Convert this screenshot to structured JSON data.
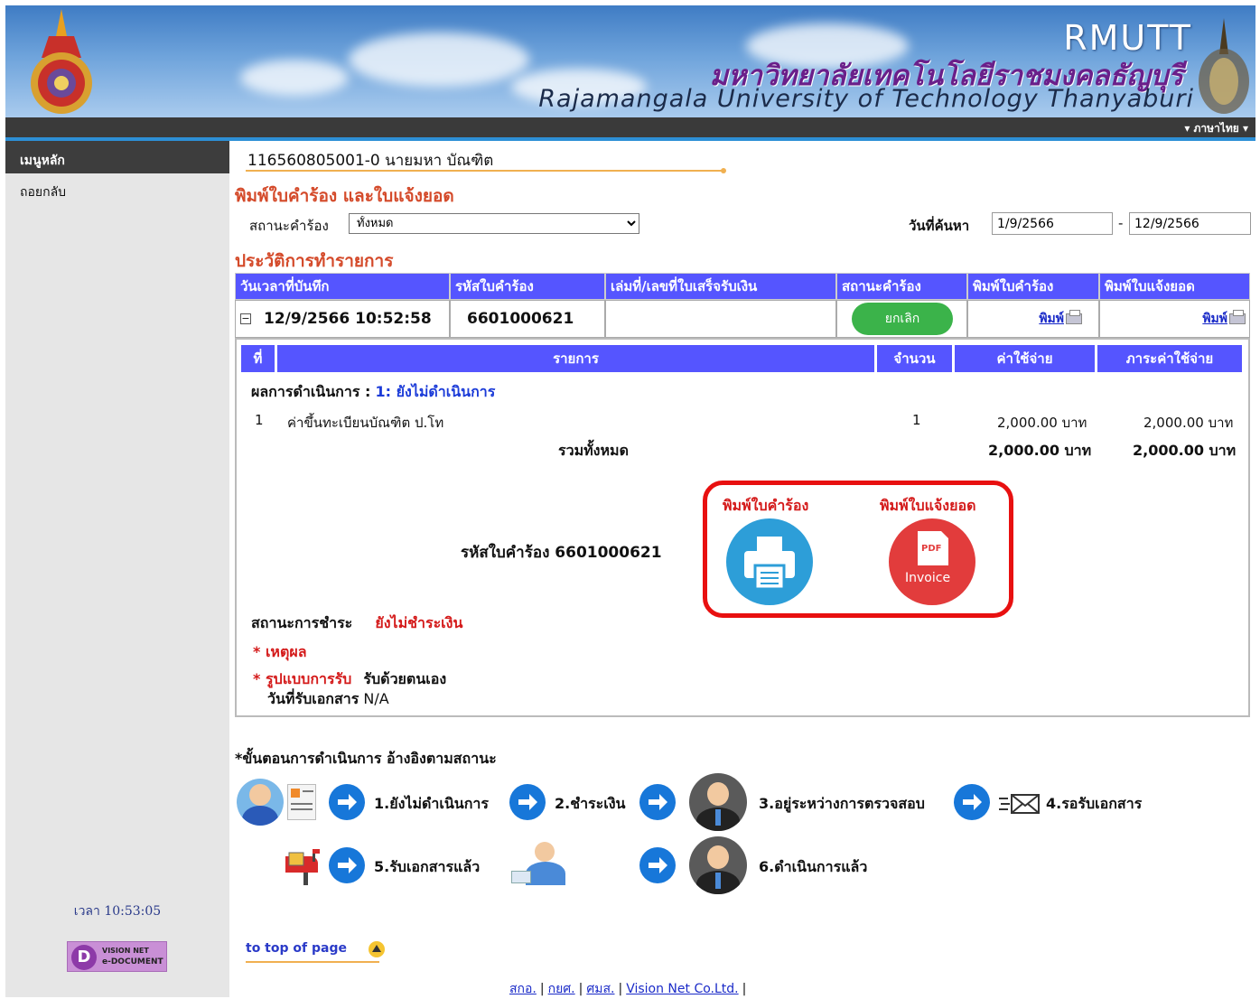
{
  "header": {
    "brand_short": "RMUTT",
    "brand_thai": "มหาวิทยาลัยเทคโนโลยีราชมงคลธัญบุรี",
    "brand_english": "Rajamangala University of Technology Thanyaburi",
    "language": "▾ ภาษาไทย ▾"
  },
  "sidebar": {
    "main_menu": "เมนูหลัก",
    "back": "ถอยกลับ",
    "clock": "เวลา 10:53:05",
    "vision_logo_line1": "VISION NET",
    "vision_logo_line2": "e-DOCUMENT"
  },
  "student": {
    "id_name": "116560805001-0 นายมหา  บัณฑิต"
  },
  "page_title": "พิมพ์ใบคำร้อง และใบแจ้งยอด",
  "filter": {
    "status_label": "สถานะคำร้อง",
    "status_value": "ทั้งหมด",
    "date_label": "วันที่ค้นหา",
    "date_from": "1/9/2566",
    "date_sep": "-",
    "date_to": "12/9/2566"
  },
  "history": {
    "title": "ประวัติการทำรายการ",
    "columns": [
      "วันเวลาที่บันทึก",
      "รหัสใบคำร้อง",
      "เล่มที่/เลขที่ใบเสร็จรับเงิน",
      "สถานะคำร้อง",
      "พิมพ์ใบคำร้อง",
      "พิมพ์ใบแจ้งยอด"
    ],
    "row": {
      "toggle": "⊟",
      "datetime": "12/9/2566 10:52:58",
      "request_code": "6601000621",
      "receipt": "",
      "status_button": "ยกเลิก",
      "print_request": "พิมพ์",
      "print_invoice": "พิมพ์"
    }
  },
  "detail": {
    "columns": [
      "ที่",
      "รายการ",
      "จำนวน",
      "ค่าใช้จ่าย",
      "ภาระค่าใช้จ่าย"
    ],
    "process_label": "ผลการดำเนินการ  :",
    "process_value": "1: ยังไม่ดำเนินการ",
    "items": [
      {
        "no": "1",
        "name": "ค่าขึ้นทะเบียนบัณฑิต ป.โท",
        "qty": "1",
        "cost": "2,000.00 บาท",
        "charge": "2,000.00 บาท"
      }
    ],
    "total_label": "รวมทั้งหมด",
    "total_cost": "2,000.00 บาท",
    "total_charge": "2,000.00 บาท",
    "request_code_text": "รหัสใบคำร้อง 6601000621",
    "print_request_label": "พิมพ์ใบคำร้อง",
    "print_invoice_label": "พิมพ์ใบแจ้งยอด",
    "pdf_badge": "PDF",
    "invoice_badge": "Invoice",
    "payment_label": "สถานะการชำระ",
    "payment_value": "ยังไม่ชำระเงิน",
    "reason_label": "* เหตุผล",
    "receive_label": "* รูปแบบการรับ",
    "receive_value": "รับด้วยตนเอง",
    "doc_date_label": "วันที่รับเอกสาร",
    "doc_date_value": "N/A"
  },
  "steps": {
    "title": "*ขั้นตอนการดำเนินการ อ้างอิงตามสถานะ",
    "labels": [
      "1.ยังไม่ดำเนินการ",
      "2.ชำระเงิน",
      "3.อยู่ระหว่างการตรวจสอบ",
      "4.รอรับเอกสาร",
      "5.รับเอกสารแล้ว",
      "6.ดำเนินการแล้ว"
    ]
  },
  "footer": {
    "to_top": "to top of page",
    "links": [
      "สกอ.",
      "กยศ.",
      "ศมส.",
      "Vision Net Co.Ltd."
    ],
    "sep": "|"
  },
  "colors": {
    "header_blue": "#5555ff",
    "title_orange": "#d44a2a",
    "highlight_red": "#e81010",
    "cancel_green": "#3bb34a",
    "link_blue": "#1b2bc8"
  }
}
